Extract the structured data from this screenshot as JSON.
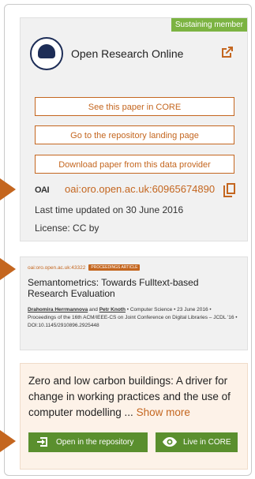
{
  "card1": {
    "badge": "Sustaining member",
    "repo_name": "Open Research Online",
    "buttons": [
      "See this paper in CORE",
      "Go to the repository landing page",
      "Download paper from this data provider"
    ],
    "oai_logo": "OAI",
    "oai_id": "oai:oro.open.ac.uk:60965674890",
    "updated": "Last time updated on 30 June 2016",
    "license": "License: CC by"
  },
  "card2": {
    "oai_id": "oai:oro.open.ac.uk:43322",
    "pill": "PROCEEDINGS ARTICLE",
    "title": "Semantometrics: Towards Fulltext-based Research Evaluation",
    "author1": "Drahomira Herrmannova",
    "and": " and ",
    "author2": "Petr Knoth",
    "meta": " • Computer Science • 23 June 2016 • Proceedings of the 16th ACM/IEEE-CS on Joint Conference on Digital Libraries – JCDL '16 • DOI:10.1145/2910896.2925448"
  },
  "card3": {
    "title": "Zero and low carbon buildings: A driver for change in working practices and the use of computer modelling ...",
    "show_more": "Show more",
    "open_repo": "Open in the repository",
    "live_core": "Live in CORE"
  },
  "colors": {
    "accent": "#c4661f",
    "green": "#5a8f2e",
    "badge": "#7cb342",
    "logo": "#1d2d57"
  },
  "icons": [
    "external-link-icon",
    "copy-icon",
    "enter-icon",
    "eye-icon"
  ]
}
